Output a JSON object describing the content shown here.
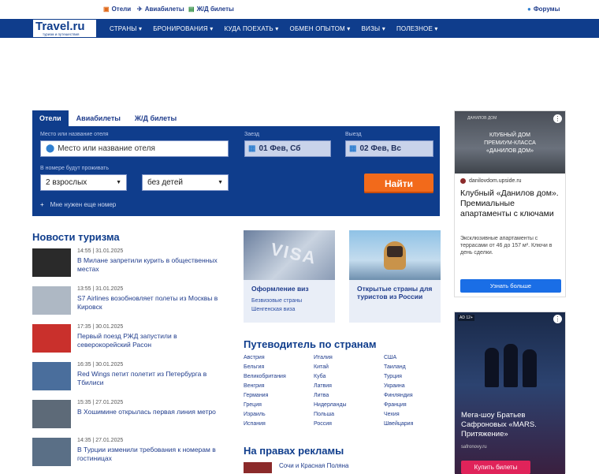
{
  "topbar": {
    "hotels": "Отели",
    "flights": "Авиабилеты",
    "trains": "Ж/Д билеты",
    "forums": "Форумы"
  },
  "logo": {
    "text": "Travel.ru",
    "tagline": "туризм и путешествия"
  },
  "nav": [
    "СТРАНЫ ▾",
    "БРОНИРОВАНИЯ ▾",
    "КУДА ПОЕХАТЬ ▾",
    "ОБМЕН ОПЫТОМ ▾",
    "ВИЗЫ ▾",
    "ПОЛЕЗНОЕ ▾"
  ],
  "search": {
    "tabs": [
      "Отели",
      "Авиабилеты",
      "Ж/Д билеты"
    ],
    "place_label": "Место или название отеля",
    "place_placeholder": "Место или название отеля",
    "checkin_label": "Заезд",
    "checkin": "01 Фев, Сб",
    "checkout_label": "Выезд",
    "checkout": "02 Фев, Вс",
    "guests_label": "В номере будут проживать",
    "adults": "2 взрослых",
    "children": "без детей",
    "submit": "Найти",
    "more_rooms": "Мне нужен еще номер"
  },
  "news": {
    "title": "Новости туризма",
    "items": [
      {
        "meta": "14:55 | 31.01.2025",
        "title": "В Милане запретили курить в общественных местах"
      },
      {
        "meta": "13:55 | 31.01.2025",
        "title": "S7 Airlines возобновляет полеты из Москвы в Кировск"
      },
      {
        "meta": "17:35 | 30.01.2025",
        "title": "Первый поезд РЖД запустили в северокорейский Расон"
      },
      {
        "meta": "16:35 | 30.01.2025",
        "title": "Red Wings петит полетит из Петербурга в Тбилиси"
      },
      {
        "meta": "15:35 | 27.01.2025",
        "title": "В Хошимине открылась первая линия метро"
      },
      {
        "meta": "14:35 | 27.01.2025",
        "title": "В Турции изменили требования к номерам в гостиницах"
      }
    ]
  },
  "cards": [
    {
      "title": "Оформление виз",
      "sub1": "Безвизовые страны",
      "sub2": "Шенгенская виза"
    },
    {
      "title": "Открытые страны для туристов из России",
      "sub1": "",
      "sub2": ""
    }
  ],
  "guide": {
    "title": "Путеводитель по странам",
    "columns": [
      [
        "Австрия",
        "Бельгия",
        "Великобритания",
        "Венгрия",
        "Германия",
        "Греция",
        "Израиль",
        "Испания"
      ],
      [
        "Италия",
        "Китай",
        "Куба",
        "Латвия",
        "Литва",
        "Нидерланды",
        "Польша",
        "Россия"
      ],
      [
        "США",
        "Таиланд",
        "Турция",
        "Украина",
        "Финляндия",
        "Франция",
        "Чехия",
        "Швейцария"
      ]
    ]
  },
  "ads_section": {
    "title": "На правах рекламы",
    "item": "Сочи и Красная Поляна"
  },
  "ad1": {
    "banner1": "КЛУБНЫЙ ДОМ",
    "banner2": "ПРЕМИУМ-КЛАССА",
    "banner3": "«ДАНИЛОВ ДОМ»",
    "small": "ДАНИЛОВ ДОМ",
    "domain": "danilovdom.upside.ru",
    "title": "Клубный «Данилов дом». Премиальные апартаменты с ключами",
    "text": "Эксклюзивные апартаменты с террасами от 46 до 157 м². Ключи в день сделки.",
    "button": "Узнать больше"
  },
  "ad2": {
    "badge": "AD 12+",
    "title": "Мега-шоу Братьев Сафроновых «MARS. Притяжение»",
    "domain": "safronovy.ru",
    "button": "Купить билеты"
  },
  "colors": {
    "brand": "#0f3d8c",
    "accent": "#f26a1b"
  }
}
